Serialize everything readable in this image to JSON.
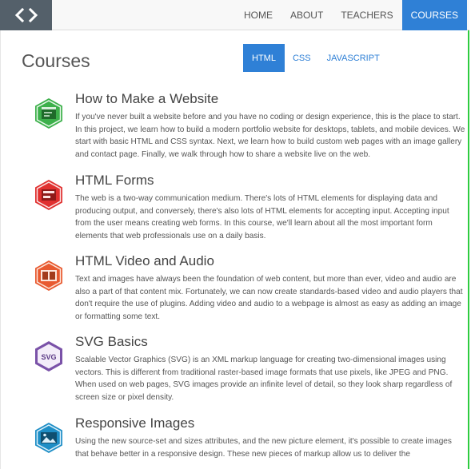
{
  "nav": {
    "logo_icon": "code-brackets-icon",
    "items": [
      {
        "label": "HOME"
      },
      {
        "label": "ABOUT"
      },
      {
        "label": "TEACHERS"
      },
      {
        "label": "COURSES",
        "active": true
      }
    ]
  },
  "page": {
    "title": "Courses",
    "tabs": [
      {
        "label": "HTML",
        "active": true
      },
      {
        "label": "CSS"
      },
      {
        "label": "JAVASCRIPT"
      }
    ]
  },
  "courses": [
    {
      "title": "How to Make a Website",
      "icon": "browser-window-icon",
      "color": "#3db04b",
      "description": "If you've never built a website before and you have no coding or design experience, this is the place to start. In this project, we learn how to build a modern portfolio website for desktops, tablets, and mobile devices. We start with basic HTML and CSS syntax. Next, we learn how to build custom web pages with an image gallery and contact page. Finally, we walk through how to share a website live on the web."
    },
    {
      "title": "HTML Forms",
      "icon": "form-icon",
      "color": "#e0302f",
      "description": "The web is a two-way communication medium. There's lots of HTML elements for displaying data and producing output, and conversely, there's also lots of HTML elements for accepting input. Accepting input from the user means creating web forms. In this course, we'll learn about all the most important form elements that web professionals use on a daily basis."
    },
    {
      "title": "HTML Video and Audio",
      "icon": "media-icon",
      "color": "#e85a30",
      "description": "Text and images have always been the foundation of web content, but more than ever, video and audio are also a part of that content mix. Fortunately, we can now create standards-based video and audio players that don't require the use of plugins. Adding video and audio to a webpage is almost as easy as adding an image or formatting some text."
    },
    {
      "title": "SVG Basics",
      "icon": "svg-icon",
      "icon_text": "SVG",
      "color": "#7a52a8",
      "description": "Scalable Vector Graphics (SVG) is an XML markup language for creating two-dimensional images using vectors. This is different from traditional raster-based image formats that use pixels, like JPEG and PNG. When used on web pages, SVG images provide an infinite level of detail, so they look sharp regardless of screen size or pixel density."
    },
    {
      "title": "Responsive Images",
      "icon": "responsive-images-icon",
      "color": "#1e8ec6",
      "description": "Using the new source-set and sizes attributes, and the new picture element, it's possible to create images that behave better in a responsive design. These new pieces of markup allow us to deliver the"
    }
  ]
}
